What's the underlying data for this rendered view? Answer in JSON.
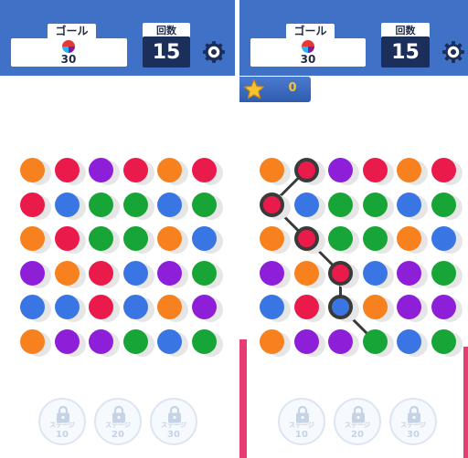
{
  "left": {
    "goal": {
      "label": "ゴール",
      "value": "30"
    },
    "moves": {
      "label": "回数",
      "value": "15"
    },
    "grid": [
      [
        "orange",
        "red",
        "purple",
        "red",
        "orange",
        "red"
      ],
      [
        "red",
        "blue",
        "green",
        "green",
        "blue",
        "green"
      ],
      [
        "orange",
        "red",
        "green",
        "green",
        "orange",
        "blue"
      ],
      [
        "purple",
        "orange",
        "red",
        "blue",
        "purple",
        "green"
      ],
      [
        "blue",
        "blue",
        "red",
        "blue",
        "orange",
        "purple"
      ],
      [
        "orange",
        "purple",
        "purple",
        "green",
        "blue",
        "green"
      ]
    ],
    "locks": [
      {
        "label": "ステージ",
        "num": "10"
      },
      {
        "label": "ステージ",
        "num": "20"
      },
      {
        "label": "ステージ",
        "num": "30"
      }
    ]
  },
  "right": {
    "goal": {
      "label": "ゴール",
      "value": "30"
    },
    "moves": {
      "label": "回数",
      "value": "15"
    },
    "score": "0",
    "grid": [
      [
        "orange",
        "red",
        "purple",
        "red",
        "orange",
        "red"
      ],
      [
        "red",
        "blue",
        "green",
        "green",
        "blue",
        "green"
      ],
      [
        "orange",
        "red",
        "green",
        "green",
        "orange",
        "blue"
      ],
      [
        "purple",
        "orange",
        "red",
        "blue",
        "purple",
        "green"
      ],
      [
        "blue",
        "red",
        "blue",
        "orange",
        "purple",
        "purple"
      ],
      [
        "orange",
        "purple",
        "purple",
        "green",
        "blue",
        "green"
      ]
    ],
    "path": [
      [
        0,
        1
      ],
      [
        1,
        0
      ],
      [
        2,
        1
      ],
      [
        3,
        2
      ],
      [
        4,
        2
      ],
      [
        5,
        3
      ]
    ],
    "selected": [
      [
        0,
        1
      ],
      [
        1,
        0
      ],
      [
        2,
        1
      ],
      [
        3,
        2
      ],
      [
        4,
        2
      ]
    ],
    "locks": [
      {
        "label": "ステージ",
        "num": "10"
      },
      {
        "label": "ステージ",
        "num": "20"
      },
      {
        "label": "ステージ",
        "num": "30"
      }
    ]
  },
  "colors": {
    "orange": "#f7811f",
    "red": "#ea1a4b",
    "purple": "#8e1fd8",
    "green": "#17a537",
    "blue": "#3a76e3",
    "header": "#3f72c7",
    "moves_bg": "#1b2f5a",
    "star": "#f7c531"
  },
  "icons": {
    "settings": "gear-icon",
    "lock": "lock-icon",
    "star": "star-icon",
    "goal": "goal-ball-icon"
  }
}
